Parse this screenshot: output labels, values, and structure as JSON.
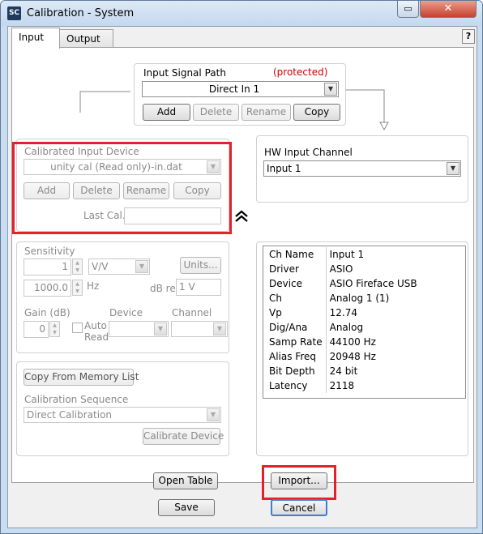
{
  "window": {
    "title": "Calibration  - System",
    "app_icon": "SC",
    "controls": [
      "restore",
      "close"
    ]
  },
  "tabs": {
    "input": "Input",
    "output": "Output",
    "help": "?"
  },
  "signal_path": {
    "label": "Input Signal Path",
    "protected": "(protected)",
    "value": "Direct In 1",
    "add": "Add",
    "delete": "Delete",
    "rename": "Rename",
    "copy": "Copy"
  },
  "cal_device": {
    "label": "Calibrated Input Device",
    "value": "unity cal (Read only)-in.dat",
    "add": "Add",
    "delete": "Delete",
    "rename": "Rename",
    "copy": "Copy",
    "last_cal_label": "Last Cal.",
    "last_cal_value": "",
    "collapse_icon": "double-chevron-up"
  },
  "hw_channel": {
    "label": "HW Input Channel",
    "value": "Input 1"
  },
  "sensitivity": {
    "label": "Sensitivity",
    "value": "1",
    "unit": "V/V",
    "units_button": "Units...",
    "freq_value": "1000.0",
    "freq_unit": "Hz",
    "dbref_label": "dB ref",
    "dbref_value": "1 V",
    "gain_label": "Gain (dB)",
    "gain_value": "0",
    "auto_read_line1": "Auto",
    "auto_read_line2": "Read",
    "device_label": "Device",
    "channel_label": "Channel"
  },
  "sequence": {
    "copy_memory": "Copy From Memory List",
    "label": "Calibration Sequence",
    "value": "Direct Calibration",
    "calibrate": "Calibrate Device"
  },
  "info": {
    "rows": [
      [
        "Ch Name",
        "Input 1"
      ],
      [
        "Driver",
        "ASIO"
      ],
      [
        "Device",
        "ASIO Fireface USB"
      ],
      [
        "Ch",
        "Analog 1 (1)"
      ],
      [
        "Vp",
        "12.74"
      ],
      [
        "Dig/Ana",
        "Analog"
      ],
      [
        "Samp Rate",
        "44100 Hz"
      ],
      [
        "Alias Freq",
        "20948 Hz"
      ],
      [
        "Bit Depth",
        "24 bit"
      ],
      [
        "Latency",
        "2118"
      ]
    ]
  },
  "footer": {
    "open_table": "Open Table",
    "import": "Import...",
    "save": "Save",
    "cancel": "Cancel"
  },
  "colors": {
    "highlight": "#e3202b",
    "protected": "#d00000"
  }
}
